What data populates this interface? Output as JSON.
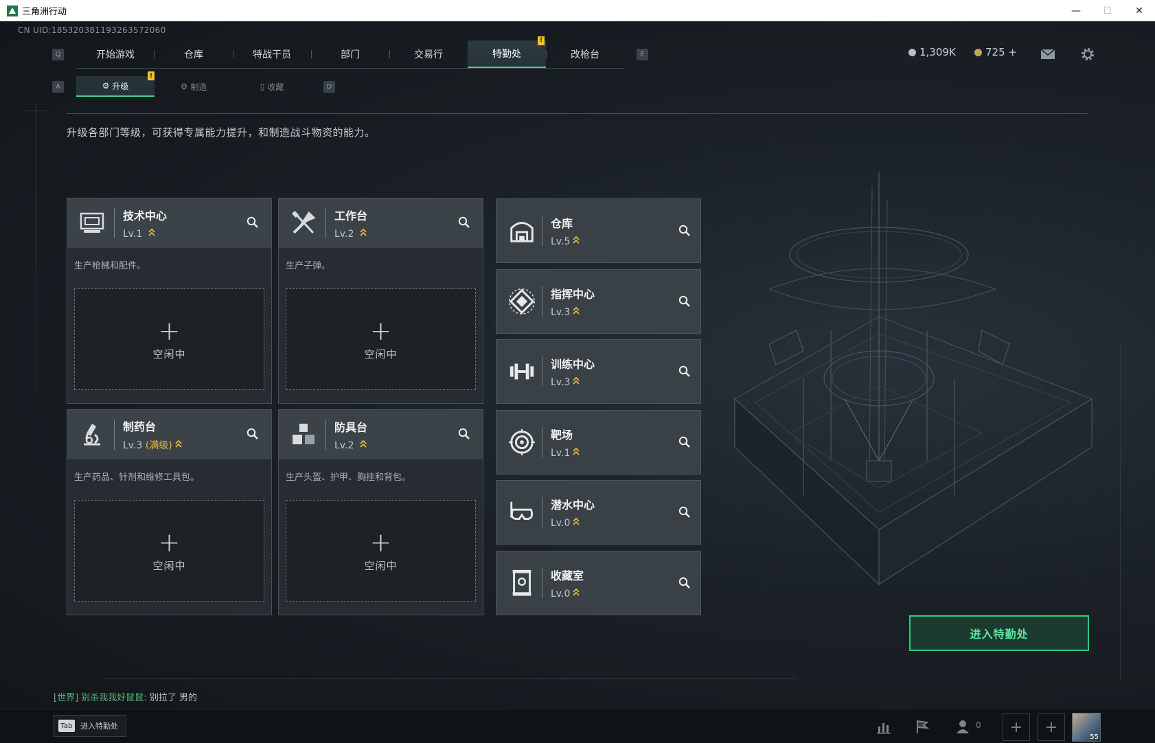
{
  "window": {
    "title": "三角洲行动",
    "minimize": "—",
    "maximize": "☐",
    "close": "✕"
  },
  "uid": "CN UID:1853203811932635720​60",
  "topnav": {
    "left_key": "Q",
    "right_key": "E",
    "tabs": [
      "开始游戏",
      "仓库",
      "特战干员",
      "部门",
      "交易行",
      "特勤处",
      "改枪台"
    ],
    "active": "特勤处",
    "badge": "!"
  },
  "currency": {
    "silver": "1,309K",
    "gold": "725 +"
  },
  "subtabs": {
    "left_key": "A",
    "right_key": "D",
    "tabs": [
      "升级",
      "制造",
      "收藏"
    ],
    "active": "升级",
    "badge": "!"
  },
  "description": "升级各部门等级，可获得专属能力提升，和制造战斗物资的能力。",
  "workshops": [
    {
      "name": "技术中心",
      "level": "Lv.1",
      "level_note": "",
      "desc": "生产枪械和配件。",
      "slot_label": "空闲中",
      "icon": "computer-icon"
    },
    {
      "name": "工作台",
      "level": "Lv.2",
      "level_note": "",
      "desc": "生产子弹。",
      "slot_label": "空闲中",
      "icon": "tools-icon"
    },
    {
      "name": "制药台",
      "level": "Lv.3",
      "level_note": "(满级)",
      "desc": "生产药品、针剂和维修工具包。",
      "slot_label": "空闲中",
      "icon": "microscope-icon"
    },
    {
      "name": "防具台",
      "level": "Lv.2",
      "level_note": "",
      "desc": "生产头盔、护甲、胸挂和背包。",
      "slot_label": "空闲中",
      "icon": "cubes-icon"
    }
  ],
  "facilities": [
    {
      "name": "仓库",
      "level": "Lv.5",
      "icon": "warehouse-icon"
    },
    {
      "name": "指挥中心",
      "level": "Lv.3",
      "icon": "command-center-icon"
    },
    {
      "name": "训练中心",
      "level": "Lv.3",
      "icon": "dumbbell-icon"
    },
    {
      "name": "靶场",
      "level": "Lv.1",
      "icon": "target-icon"
    },
    {
      "name": "潜水中心",
      "level": "Lv.0",
      "icon": "diving-mask-icon"
    },
    {
      "name": "收藏室",
      "level": "Lv.0",
      "icon": "trophy-case-icon"
    }
  ],
  "plus": "+",
  "enter_button": "进入特勤处",
  "chat": {
    "channel": "[世界]",
    "nick": "别杀我我好鼠鼠:",
    "message": "别拉了 男的"
  },
  "bottombar": {
    "tab_key": "Tab",
    "tab_label": "进入特勤处",
    "friends_count": "0",
    "avatar_level": "55"
  },
  "colors": {
    "accent": "#3fd48d",
    "badge": "#f2c12e",
    "level_chevron": "#e8b93b"
  }
}
